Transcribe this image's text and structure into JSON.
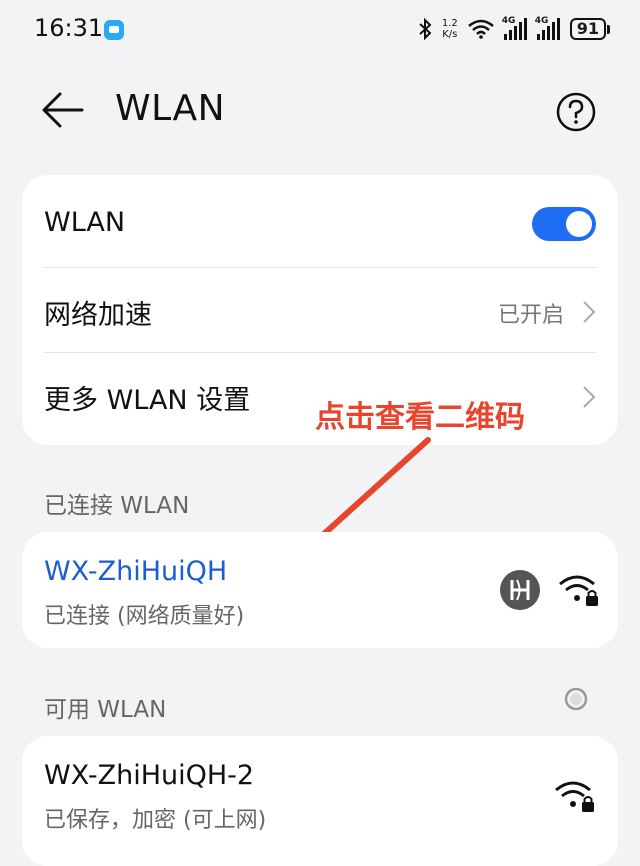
{
  "status_bar": {
    "time": "16:31",
    "net_speed_value": "1.2",
    "net_speed_unit": "K/s",
    "signal1_label": "4G",
    "signal2_label": "4G",
    "battery": "91",
    "icons": [
      "chat-notification-icon",
      "bluetooth-icon",
      "wifi-icon",
      "signal-icon",
      "battery-icon"
    ]
  },
  "header": {
    "title": "WLAN"
  },
  "settings": {
    "wlan_label": "WLAN",
    "wlan_enabled": true,
    "accel_label": "网络加速",
    "accel_value": "已开启",
    "more_label": "更多 WLAN 设置"
  },
  "annotation": "点击查看二维码",
  "connected": {
    "section_label": "已连接 WLAN",
    "ssid": "WX-ZhiHuiQH",
    "status": "已连接 (网络质量好)"
  },
  "available": {
    "section_label": "可用 WLAN",
    "networks": [
      {
        "ssid": "WX-ZhiHuiQH-2",
        "status": "已保存，加密 (可上网)"
      }
    ]
  },
  "colors": {
    "accent": "#1e6df2",
    "annotation": "#e8452f",
    "link": "#1b5ecf"
  }
}
